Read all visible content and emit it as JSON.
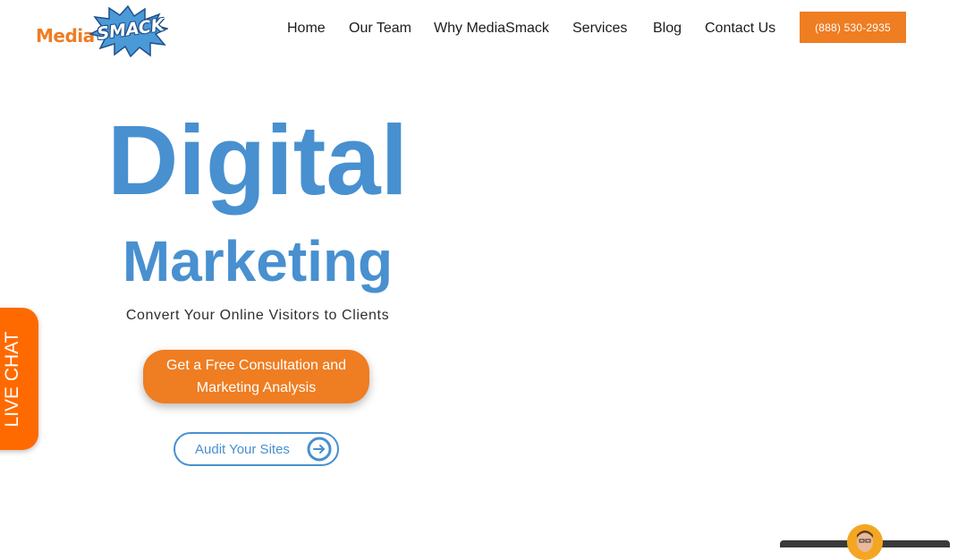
{
  "header": {
    "logo": {
      "word1": "Media",
      "word2": "SMACK"
    },
    "nav": [
      {
        "label": "Home"
      },
      {
        "label": "Our Team"
      },
      {
        "label": "Why MediaSmack"
      },
      {
        "label": "Services"
      },
      {
        "label": "Blog"
      },
      {
        "label": "Contact Us"
      }
    ],
    "phone": "(888) 530-2935"
  },
  "hero": {
    "title_line1": "Digital",
    "title_line2": "Marketing",
    "subtitle": "Convert Your Online Visitors to Clients",
    "cta_label": "Get a Free Consultation and Marketing Analysis",
    "audit_label": "Audit Your Sites"
  },
  "live_chat": {
    "label": "LIVE CHAT"
  },
  "colors": {
    "brand_orange": "#ef7d22",
    "brand_blue": "#4890d0",
    "live_chat_orange": "#ff6a00"
  },
  "icons": {
    "audit": "arrow-right-circle-icon",
    "logo_burst": "starburst-icon"
  }
}
